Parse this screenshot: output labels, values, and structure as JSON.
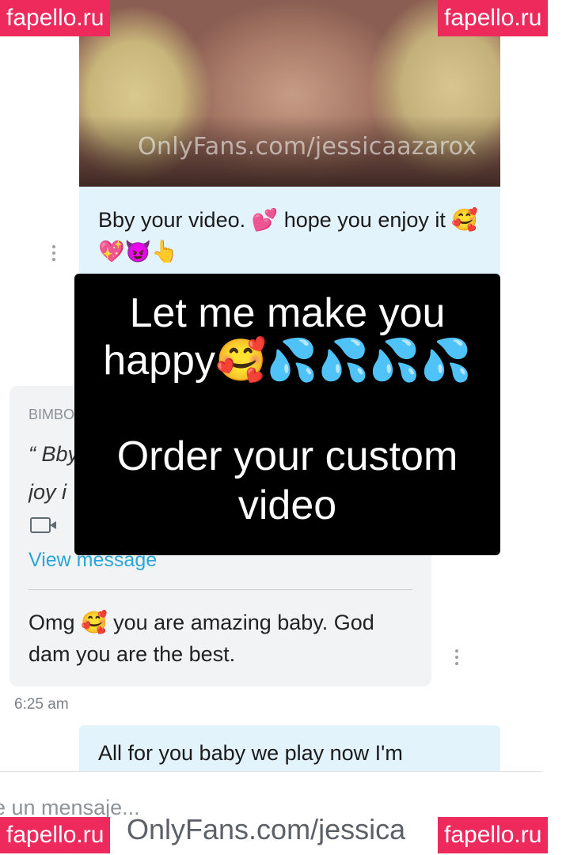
{
  "watermarks": {
    "badge_text": "fapello.ru",
    "photo_caption": "OnlyFans.com/jessicaazarox",
    "bottom_caption": "OnlyFans.com/jessica"
  },
  "chat": {
    "sent_message": "Bby your video. 💕 hope you enjoy it 🥰💖😈👆",
    "reply_card": {
      "sender": "BIMBO",
      "quote": "“ Bby\njoy i",
      "media_icon": "video-camera-icon",
      "view_link": "View message",
      "message": "Omg 🥰 you are amazing baby. God dam you are the best."
    },
    "timestamp": "6:25 am",
    "sent_message_2": "All for you baby we play now I'm",
    "input_placeholder": "e un mensaje..."
  },
  "promo": {
    "line1": "Let me make you happy🥰💦💦💦💦",
    "line2": "Order your custom video"
  },
  "colors": {
    "sent_bubble": "#e3f3fc",
    "received_card": "#f1f3f4",
    "link": "#2aa6d8",
    "badge": "#ee2a5d",
    "promo_bg": "#000000"
  }
}
